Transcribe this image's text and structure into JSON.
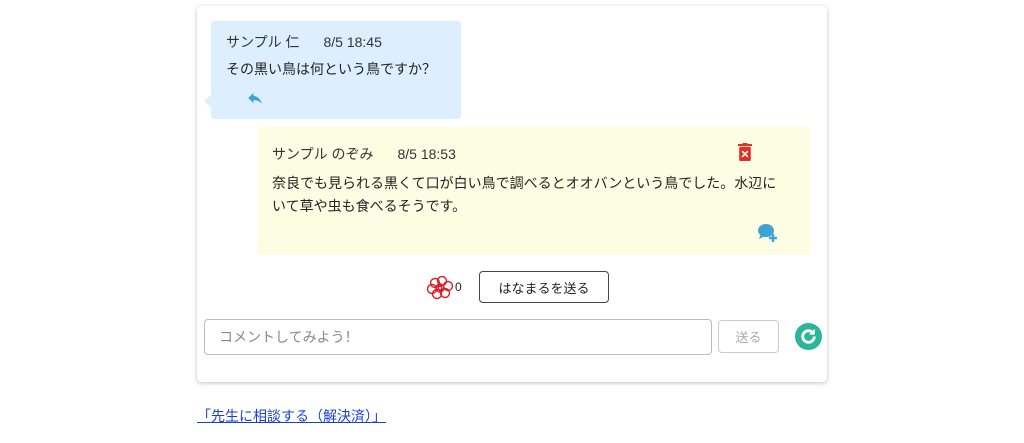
{
  "thread": {
    "question": {
      "author": "サンプル 仁",
      "time": "8/5 18:45",
      "text": "その黒い鳥は何という鳥ですか？",
      "reply_icon": "reply-icon"
    },
    "answer": {
      "author": "サンプル のぞみ",
      "time": "8/5 18:53",
      "text": "奈良でも見られる黒くて口が白い鳥で調べるとオオバンという鳥でした。水辺にいて草や虫も食べるそうです。",
      "delete_icon": "trash-icon",
      "add_comment_icon": "comment-add-icon"
    }
  },
  "hanamaru": {
    "icon": "flower-icon",
    "count": "0",
    "button_label": "はなまるを送る"
  },
  "comment_box": {
    "placeholder": "コメントしてみよう！",
    "send_label": "送る",
    "refresh_icon": "refresh-icon"
  },
  "consult_link": "「先生に相談する（解決済）」",
  "colors": {
    "question_bg": "#ddeeff",
    "answer_bg": "#fdfde3",
    "icon_blue": "#3fa3d8",
    "delete_red": "#e0302a",
    "refresh_teal": "#2bb59a",
    "link_blue": "#1a3fd6"
  }
}
